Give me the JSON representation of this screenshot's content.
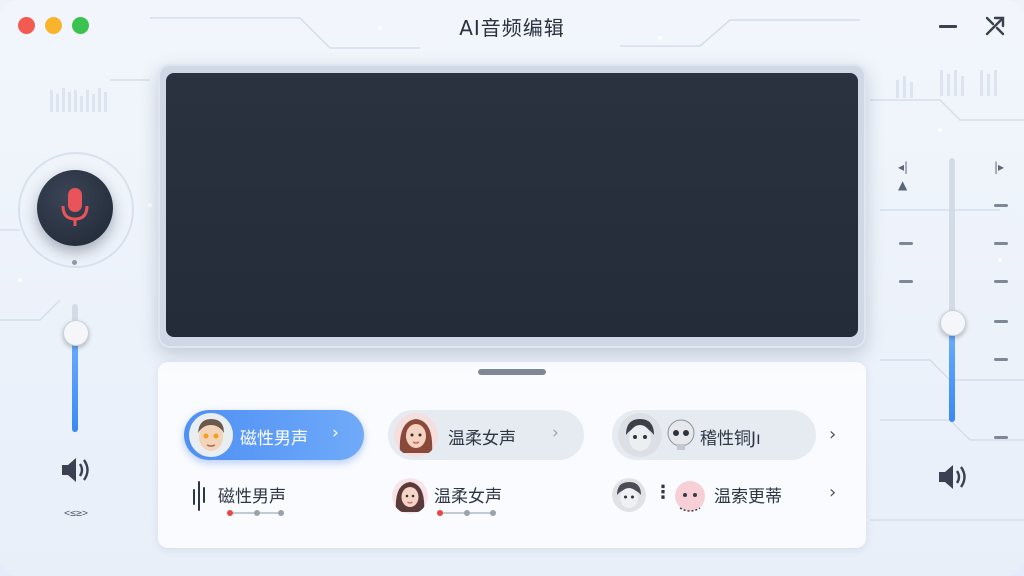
{
  "window": {
    "title": "AI音频编辑"
  },
  "left_panel": {
    "volume_level": 0.7,
    "volume_code": "<≤≥>"
  },
  "right_panel": {
    "volume_level": 0.38
  },
  "voices": {
    "chips": [
      {
        "label": "磁性男声",
        "active": true
      },
      {
        "label": "温柔女声",
        "active": false
      },
      {
        "label": "稽性铜Jı",
        "active": false
      }
    ],
    "row2": [
      {
        "label": "磁性男声"
      },
      {
        "label": "温柔女声"
      },
      {
        "label": "温索更蒂"
      }
    ]
  },
  "colors": {
    "accent": "#4d8ff4",
    "wave_start": "#7fbdf5",
    "wave_end": "#f2a865",
    "screen": "#262e3c"
  }
}
